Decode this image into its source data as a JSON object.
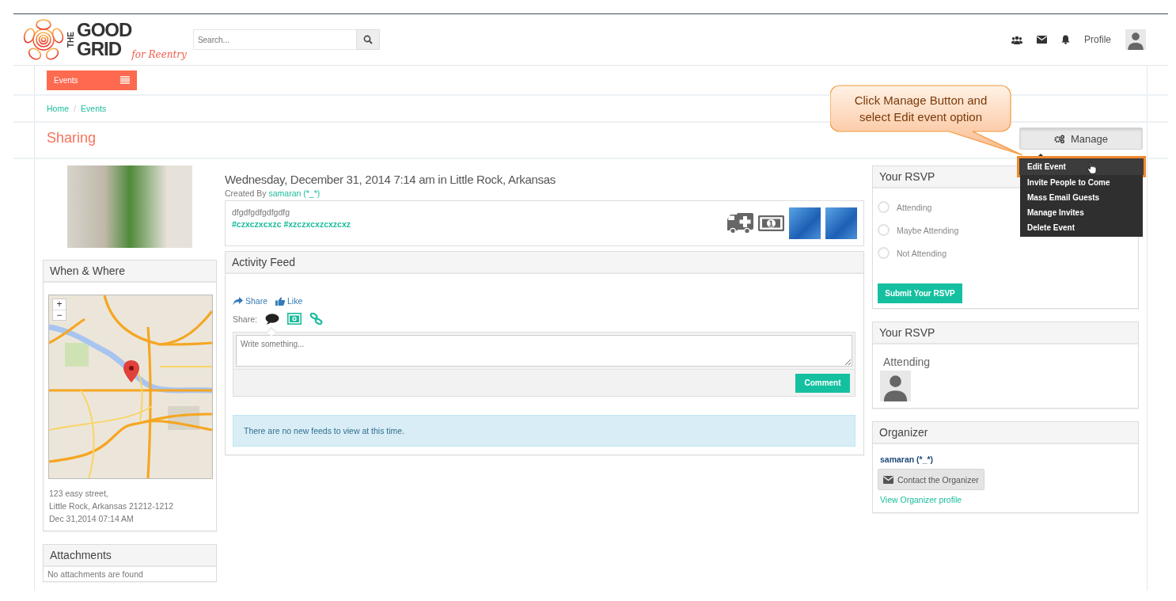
{
  "header": {
    "logo": {
      "top": "THE",
      "word1": "GOOD",
      "word2": "GRID",
      "tagline": "for Reentry"
    },
    "search": {
      "placeholder": "Search..."
    },
    "profile_label": "Profile"
  },
  "nav": {
    "menu_button": "Events"
  },
  "breadcrumb": {
    "items": [
      {
        "label": "Home"
      },
      {
        "label": "Events"
      }
    ],
    "separator": "/"
  },
  "page_title": "Sharing",
  "manage": {
    "label": "Manage",
    "expanded": true,
    "menu": [
      {
        "label": "Edit Event",
        "selected": true
      },
      {
        "label": "Invite People to Come",
        "selected": false
      },
      {
        "label": "Mass Email Guests",
        "selected": false
      },
      {
        "label": "Manage Invites",
        "selected": false
      },
      {
        "label": "Delete Event",
        "selected": false
      }
    ]
  },
  "callout": "Click Manage Button and select Edit event option",
  "when_where": {
    "title": "When & Where",
    "map": {
      "zoom_in": "+",
      "zoom_out": "−"
    },
    "address_lines": [
      "123 easy street,",
      "Little Rock, Arkansas 21212-1212",
      "Dec 31,2014 07:14 AM"
    ]
  },
  "attachments": {
    "title": "Attachments",
    "empty_text": "No attachments are found"
  },
  "event": {
    "heading": "Wednesday, December 31, 2014 7:14 am in Little Rock, Arkansas",
    "created_by_label": "Created By",
    "creator": "samaran (*_*)",
    "description": "dfgdfgdfgdfgdfg",
    "tags": "#czxczxcxzc #xzczxcxzcxzcxz"
  },
  "activity_feed": {
    "title": "Activity Feed",
    "actions": [
      {
        "kind": "share",
        "label": "Share"
      },
      {
        "kind": "like",
        "label": "Like"
      }
    ],
    "share_label": "Share:",
    "share_types": [
      {
        "kind": "status",
        "selected": true
      },
      {
        "kind": "photo",
        "selected": false
      },
      {
        "kind": "link",
        "selected": false
      }
    ],
    "composer": {
      "placeholder": "Write something..."
    },
    "comment_button": "Comment",
    "empty_notice": "There are no new feeds to view at this time."
  },
  "rsvp": {
    "title": "Your RSVP",
    "options": [
      {
        "label": "Attending",
        "selected": false
      },
      {
        "label": "Maybe Attending",
        "selected": false
      },
      {
        "label": "Not Attending",
        "selected": false
      }
    ],
    "submit": "Submit Your RSVP"
  },
  "attendees": {
    "title": "Your RSVP",
    "status": "Attending"
  },
  "organizer": {
    "title": "Organizer",
    "name": "samaran (*_*)",
    "contact_button": "Contact the Organizer",
    "profile_link": "View Organizer profile"
  }
}
